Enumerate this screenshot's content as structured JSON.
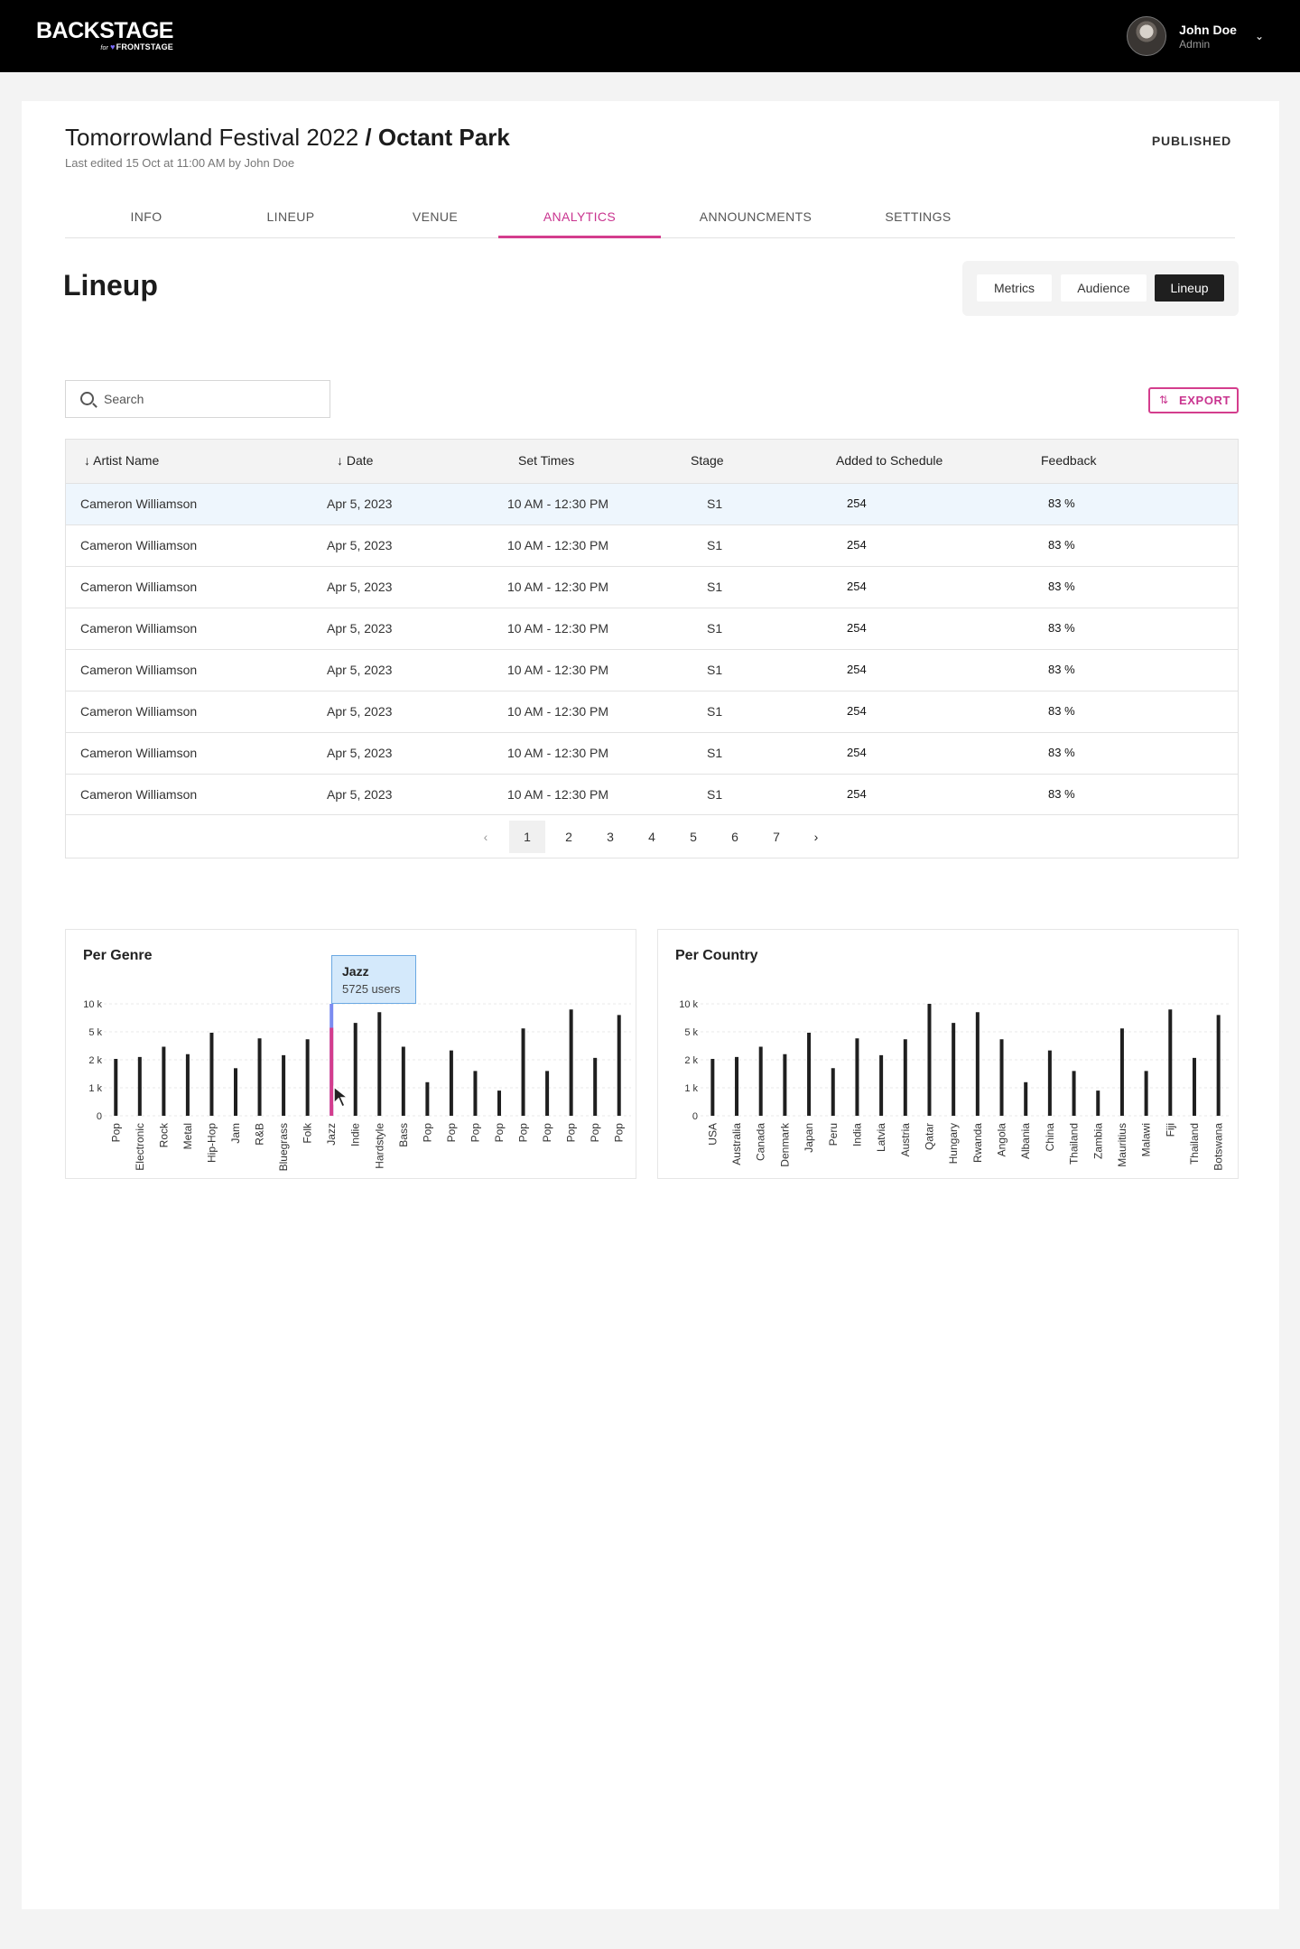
{
  "brand": {
    "name": "BACKSTAGE",
    "sub_for": "for",
    "sub_name": "FRONTSTAGE"
  },
  "user": {
    "name": "John Doe",
    "role": "Admin"
  },
  "event": {
    "title_light": "Tomorrowland Festival 2022",
    "title_sep": "/",
    "title_bold": "Octant Park",
    "last_edited": "Last edited 15 Oct at 11:00 AM by John Doe",
    "status": "PUBLISHED"
  },
  "tabs": [
    {
      "label": "INFO"
    },
    {
      "label": "LINEUP"
    },
    {
      "label": "VENUE"
    },
    {
      "label": "ANALYTICS",
      "active": true
    },
    {
      "label": "ANNOUNCMENTS"
    },
    {
      "label": "SETTINGS"
    }
  ],
  "section": {
    "title": "Lineup"
  },
  "segments": [
    {
      "label": "Metrics"
    },
    {
      "label": "Audience"
    },
    {
      "label": "Lineup",
      "active": true
    }
  ],
  "search": {
    "placeholder": "Search",
    "value": ""
  },
  "export": {
    "label": "EXPORT"
  },
  "table": {
    "columns": [
      "Artist Name",
      "Date",
      "Set Times",
      "Stage",
      "Added to Schedule",
      "Feedback"
    ],
    "rows": [
      [
        "Cameron Williamson",
        "Apr 5, 2023",
        "10 AM - 12:30 PM",
        "S1",
        "254",
        "83 %"
      ],
      [
        "Cameron Williamson",
        "Apr 5, 2023",
        "10 AM - 12:30 PM",
        "S1",
        "254",
        "83 %"
      ],
      [
        "Cameron Williamson",
        "Apr 5, 2023",
        "10 AM - 12:30 PM",
        "S1",
        "254",
        "83 %"
      ],
      [
        "Cameron Williamson",
        "Apr 5, 2023",
        "10 AM - 12:30 PM",
        "S1",
        "254",
        "83 %"
      ],
      [
        "Cameron Williamson",
        "Apr 5, 2023",
        "10 AM - 12:30 PM",
        "S1",
        "254",
        "83 %"
      ],
      [
        "Cameron Williamson",
        "Apr 5, 2023",
        "10 AM - 12:30 PM",
        "S1",
        "254",
        "83 %"
      ],
      [
        "Cameron Williamson",
        "Apr 5, 2023",
        "10 AM - 12:30 PM",
        "S1",
        "254",
        "83 %"
      ],
      [
        "Cameron Williamson",
        "Apr 5, 2023",
        "10 AM - 12:30 PM",
        "S1",
        "254",
        "83 %"
      ]
    ]
  },
  "pagination": {
    "pages": [
      "1",
      "2",
      "3",
      "4",
      "5",
      "6",
      "7"
    ],
    "current": "1",
    "prev_icon": "chevron-left-icon",
    "next_icon": "chevron-right-icon"
  },
  "tooltip": {
    "title": "Jazz",
    "value": "5725 users"
  },
  "colors": {
    "accent": "#d43d8d",
    "highlight": "#7b8cf0",
    "bar": "#1f1f1f"
  },
  "chart_data": [
    {
      "type": "bar",
      "title": "Per Genre",
      "yticks": [
        "0",
        "1 k",
        "2 k",
        "5 k",
        "10 k"
      ],
      "categories": [
        "Pop",
        "Electronic",
        "Rock",
        "Metal",
        "Hip-Hop",
        "Jam",
        "R&B",
        "Bluegrass",
        "Folk",
        "Jazz",
        "Indie",
        "Hardstyle",
        "Bass",
        "Pop",
        "Pop",
        "Pop",
        "Pop",
        "Pop",
        "Pop",
        "Pop",
        "Pop",
        "Pop"
      ],
      "values": [
        2100,
        2300,
        3400,
        2600,
        4900,
        1700,
        4300,
        2500,
        4200,
        10000,
        6600,
        8500,
        3400,
        1200,
        3000,
        1600,
        900,
        5600,
        1600,
        9000,
        2200,
        8000
      ],
      "highlight_index": 9,
      "highlight_value": 5725,
      "grid": true
    },
    {
      "type": "bar",
      "title": "Per Country",
      "yticks": [
        "0",
        "1 k",
        "2 k",
        "5 k",
        "10 k"
      ],
      "categories": [
        "USA",
        "Australia",
        "Canada",
        "Denmark",
        "Japan",
        "Peru",
        "India",
        "Latvia",
        "Austria",
        "Qatar",
        "Hungary",
        "Rwanda",
        "Angola",
        "Albania",
        "China",
        "Thailand",
        "Zambia",
        "Mauritius",
        "Malawi",
        "Fiji",
        "Thailand",
        "Botswana"
      ],
      "values": [
        2100,
        2300,
        3400,
        2600,
        4900,
        1700,
        4300,
        2500,
        4200,
        10000,
        6600,
        8500,
        4200,
        1200,
        3000,
        1600,
        900,
        5600,
        1600,
        9000,
        2200,
        8000
      ],
      "grid": true
    }
  ]
}
